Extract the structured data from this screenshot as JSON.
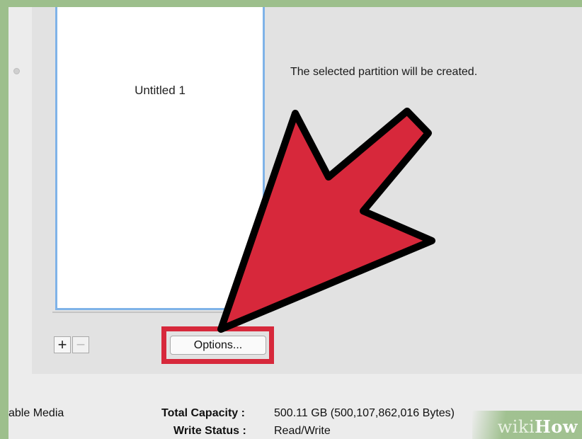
{
  "partition": {
    "name": "Untitled 1"
  },
  "message": "The selected partition will be created.",
  "controls": {
    "add_label": "+",
    "remove_label": "−",
    "options_label": "Options..."
  },
  "info": {
    "media_label": "able Media",
    "total_capacity_label": "Total Capacity :",
    "total_capacity_value": "500.11 GB (500,107,862,016 Bytes)",
    "write_status_label": "Write Status :",
    "write_status_value": "Read/Write"
  },
  "watermark": {
    "wiki": "wiki",
    "how": "How"
  },
  "colors": {
    "arrow": "#d7283b",
    "highlight": "#d7283b",
    "frame": "#9dbf8c",
    "selection_border": "#7fb3e8"
  }
}
